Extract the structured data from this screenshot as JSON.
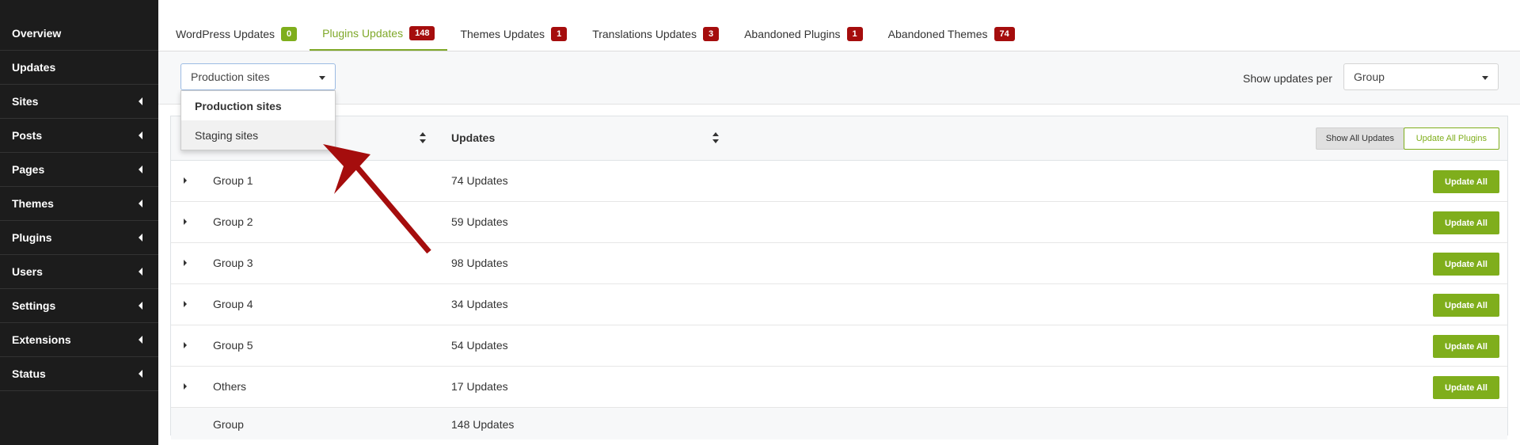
{
  "sidebar": {
    "items": [
      {
        "label": "Overview",
        "has_caret": false
      },
      {
        "label": "Updates",
        "has_caret": false
      },
      {
        "label": "Sites",
        "has_caret": true
      },
      {
        "label": "Posts",
        "has_caret": true
      },
      {
        "label": "Pages",
        "has_caret": true
      },
      {
        "label": "Themes",
        "has_caret": true
      },
      {
        "label": "Plugins",
        "has_caret": true
      },
      {
        "label": "Users",
        "has_caret": true
      },
      {
        "label": "Settings",
        "has_caret": true
      },
      {
        "label": "Extensions",
        "has_caret": true
      },
      {
        "label": "Status",
        "has_caret": true
      }
    ]
  },
  "tabs": [
    {
      "label": "WordPress Updates",
      "count": "0",
      "badge_color": "green",
      "active": false
    },
    {
      "label": "Plugins Updates",
      "count": "148",
      "badge_color": "red",
      "active": true
    },
    {
      "label": "Themes Updates",
      "count": "1",
      "badge_color": "red",
      "active": false
    },
    {
      "label": "Translations Updates",
      "count": "3",
      "badge_color": "red",
      "active": false
    },
    {
      "label": "Abandoned Plugins",
      "count": "1",
      "badge_color": "red",
      "active": false
    },
    {
      "label": "Abandoned Themes",
      "count": "74",
      "badge_color": "red",
      "active": false
    }
  ],
  "filter": {
    "site_select_value": "Production sites",
    "site_options": [
      "Production sites",
      "Staging sites"
    ],
    "show_per_label": "Show updates per",
    "group_select_value": "Group"
  },
  "table": {
    "col_updates": "Updates",
    "show_all_label": "Show All Updates",
    "update_all_plugins_label": "Update All Plugins",
    "rows": [
      {
        "name": "Group 1",
        "count": "74 Updates",
        "button": "Update All"
      },
      {
        "name": "Group 2",
        "count": "59 Updates",
        "button": "Update All"
      },
      {
        "name": "Group 3",
        "count": "98 Updates",
        "button": "Update All"
      },
      {
        "name": "Group 4",
        "count": "34 Updates",
        "button": "Update All"
      },
      {
        "name": "Group 5",
        "count": "54 Updates",
        "button": "Update All"
      },
      {
        "name": "Others",
        "count": "17 Updates",
        "button": "Update All"
      }
    ],
    "footer": {
      "name": "Group",
      "count": "148 Updates"
    }
  },
  "colors": {
    "sidebar_bg": "#1c1c1c",
    "accent_green": "#7fae1c",
    "badge_red": "#a50d0d",
    "arrow_red": "#a50d0d"
  }
}
